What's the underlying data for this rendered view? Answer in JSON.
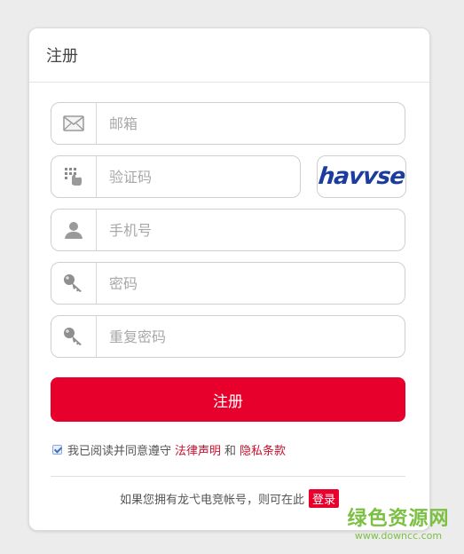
{
  "header": {
    "title": "注册"
  },
  "fields": {
    "email": {
      "placeholder": "邮箱",
      "icon": "mail-icon"
    },
    "captcha": {
      "placeholder": "验证码",
      "icon": "keypad-icon",
      "image_text": "havvse"
    },
    "phone": {
      "placeholder": "手机号",
      "icon": "user-icon"
    },
    "password": {
      "placeholder": "密码",
      "icon": "key-icon"
    },
    "confirm_password": {
      "placeholder": "重复密码",
      "icon": "key-icon"
    }
  },
  "register_button": {
    "label": "注册"
  },
  "agreement": {
    "checked": true,
    "prefix": "我已阅读并同意遵守",
    "legal_link": "法律声明",
    "and": "和",
    "privacy_link": "隐私条款"
  },
  "login": {
    "text": "如果您拥有龙弋电竞帐号，则可在此",
    "button_label": "登录"
  },
  "watermark": {
    "title": "绿色资源网",
    "url": "www.downcc.com"
  },
  "colors": {
    "accent": "#e8002c",
    "link": "#c8102e",
    "watermark": "#7bc043"
  }
}
